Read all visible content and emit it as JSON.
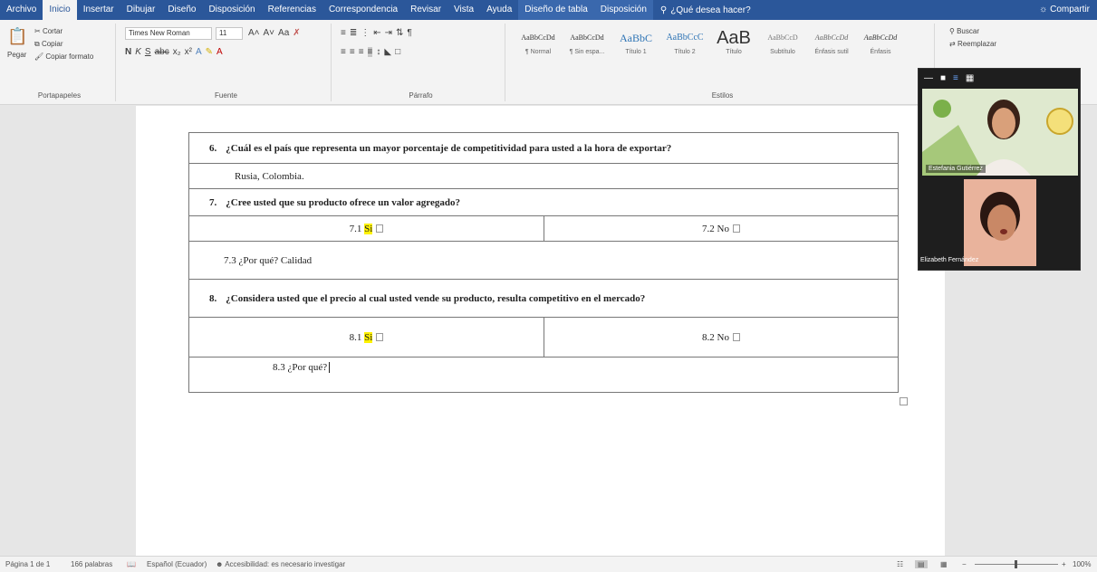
{
  "ribbon_tabs": [
    "Archivo",
    "Inicio",
    "Insertar",
    "Dibujar",
    "Diseño",
    "Disposición",
    "Referencias",
    "Correspondencia",
    "Revisar",
    "Vista",
    "Ayuda",
    "Diseño de tabla",
    "Disposición"
  ],
  "tell_me": "¿Qué desea hacer?",
  "share": "Compartir",
  "clipboard": {
    "paste": "Pegar",
    "cut": "Cortar",
    "copy": "Copiar",
    "format_painter": "Copiar formato",
    "label": "Portapapeles"
  },
  "font": {
    "name": "Times New Roman",
    "size": "11",
    "label": "Fuente"
  },
  "paragraph_label": "Párrafo",
  "styles": {
    "items": [
      {
        "sample": "AaBbCcDd",
        "name": "¶ Normal"
      },
      {
        "sample": "AaBbCcDd",
        "name": "¶ Sin espa..."
      },
      {
        "sample": "AaBbC",
        "name": "Título 1"
      },
      {
        "sample": "AaBbCcC",
        "name": "Título 2"
      },
      {
        "sample": "AaB",
        "name": "Título"
      },
      {
        "sample": "AaBbCcD",
        "name": "Subtítulo"
      },
      {
        "sample": "AaBbCcDd",
        "name": "Énfasis sutil"
      },
      {
        "sample": "AaBbCcDd",
        "name": "Énfasis"
      }
    ],
    "label": "Estilos"
  },
  "editing": {
    "find": "Buscar",
    "replace": "Reemplazar"
  },
  "document": {
    "q6": {
      "number": "6.",
      "text": "¿Cuál es el país que representa un mayor porcentaje de competitividad para usted a la hora de exportar?"
    },
    "a6": "Rusia, Colombia.",
    "q7": {
      "number": "7.",
      "text": "¿Cree usted que su producto ofrece un valor agregado?"
    },
    "o71": {
      "prefix": "7.1",
      "label": "Si"
    },
    "o72": {
      "prefix": "7.2",
      "label": "No"
    },
    "why7": "7.3 ¿Por qué?  Calidad",
    "q8": {
      "number": "8.",
      "text": "¿Considera usted que el precio al cual usted vende su producto, resulta competitivo en el mercado?"
    },
    "o81": {
      "prefix": "8.1",
      "label": "Si"
    },
    "o82": {
      "prefix": "8.2",
      "label": "No"
    },
    "why8": "8.3 ¿Por qué?"
  },
  "video": {
    "participant1": "Estefania Gutiérrez",
    "participant2": "Elizabeth Fernández"
  },
  "statusbar": {
    "page": "Página 1 de 1",
    "words": "166 palabras",
    "language": "Español (Ecuador)",
    "accessibility": "Accesibilidad: es necesario investigar",
    "zoom": "100%"
  },
  "colors": {
    "accent": "#2b579a",
    "highlight": "#fff200"
  }
}
